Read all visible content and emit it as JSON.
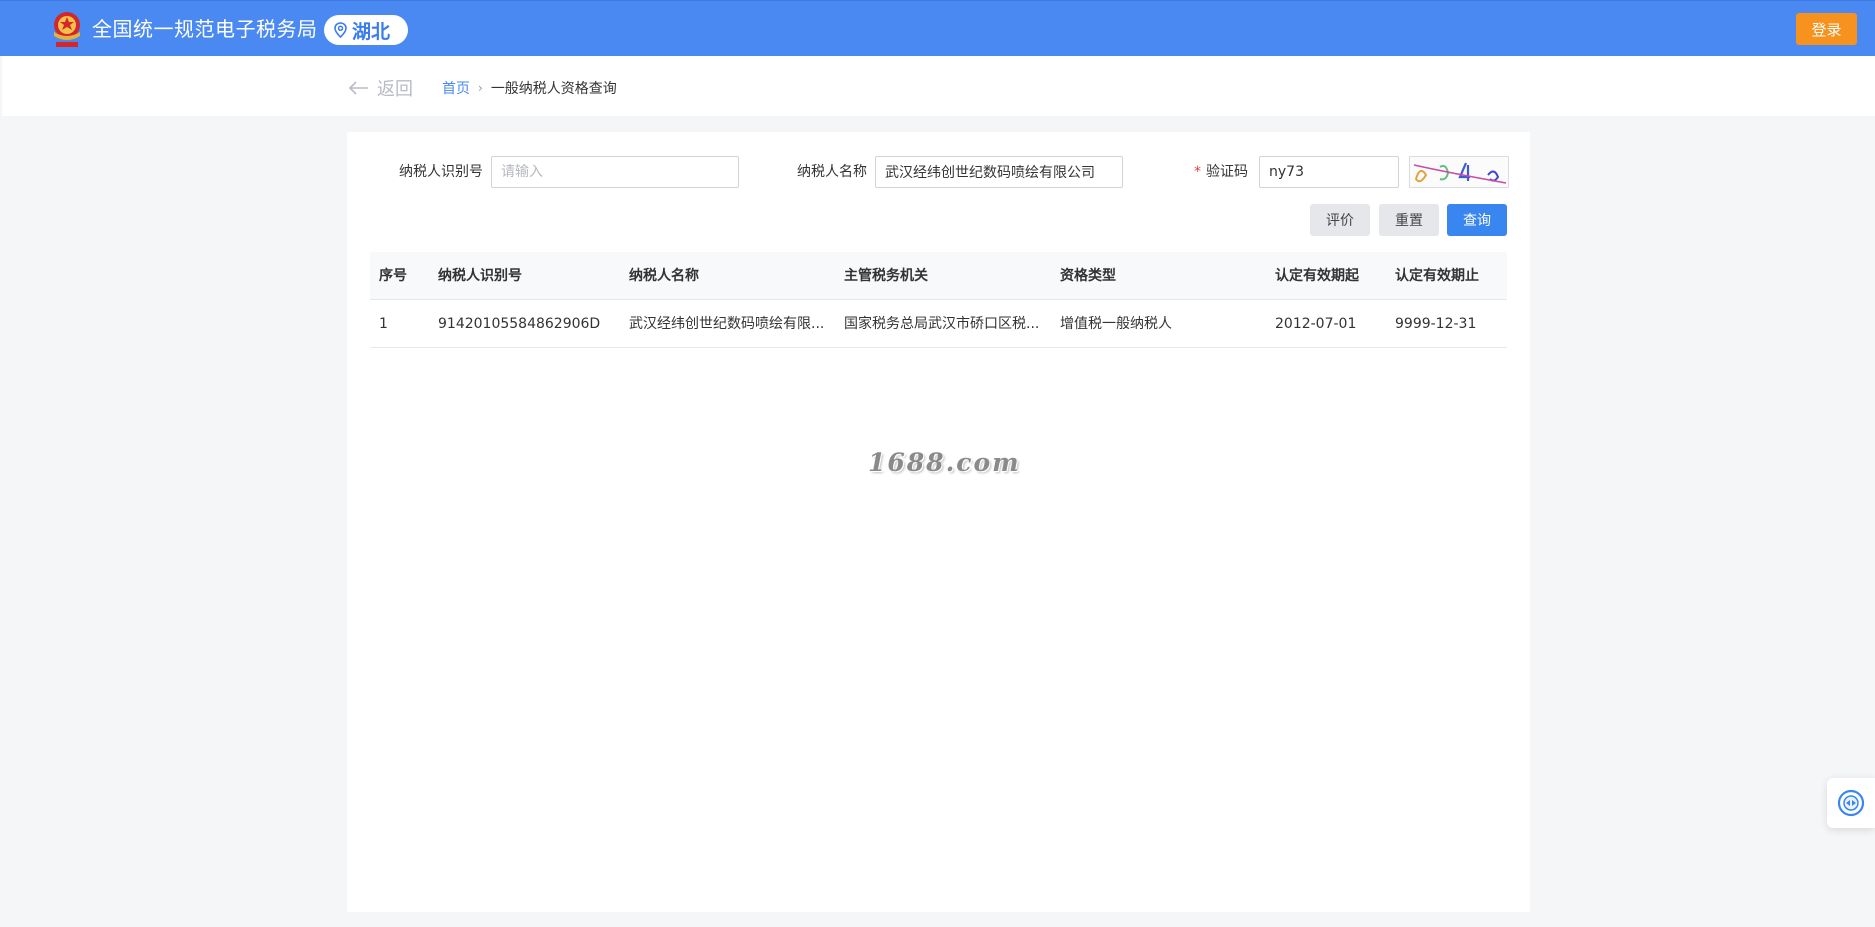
{
  "header": {
    "site_title": "全国统一规范电子税务局",
    "region": "湖北",
    "login_label": "登录"
  },
  "nav": {
    "back_label": "返回",
    "breadcrumb_home": "首页",
    "breadcrumb_current": "一般纳税人资格查询"
  },
  "form": {
    "taxpayer_id_label": "纳税人识别号",
    "taxpayer_id_placeholder": "请输入",
    "taxpayer_id_value": "",
    "taxpayer_name_label": "纳税人名称",
    "taxpayer_name_value": "武汉经纬创世纪数码喷绘有限公司",
    "captcha_required_mark": "*",
    "captcha_label": "验证码",
    "captcha_value": "ny73",
    "evaluate_label": "评价",
    "reset_label": "重置",
    "query_label": "查询"
  },
  "table": {
    "headers": [
      "序号",
      "纳税人识别号",
      "纳税人名称",
      "主管税务机关",
      "资格类型",
      "认定有效期起",
      "认定有效期止"
    ],
    "rows": [
      [
        "1",
        "91420105584862906D",
        "武汉经纬创世纪数码喷绘有限...",
        "国家税务总局武汉市硚口区税...",
        "增值税一般纳税人",
        "2012-07-01",
        "9999-12-31"
      ]
    ]
  },
  "watermark": "1688.com",
  "colors": {
    "header_bg": "#4a88f2",
    "login_bg": "#f7921e",
    "primary_button": "#3a86f1",
    "required_mark": "#e64340"
  },
  "icons": {
    "logo": "tax-emblem-icon",
    "region": "location-pin-icon",
    "back": "arrow-left-icon",
    "breadcrumb_separator": "chevron-right-icon",
    "float_widget": "service-assistant-icon"
  }
}
